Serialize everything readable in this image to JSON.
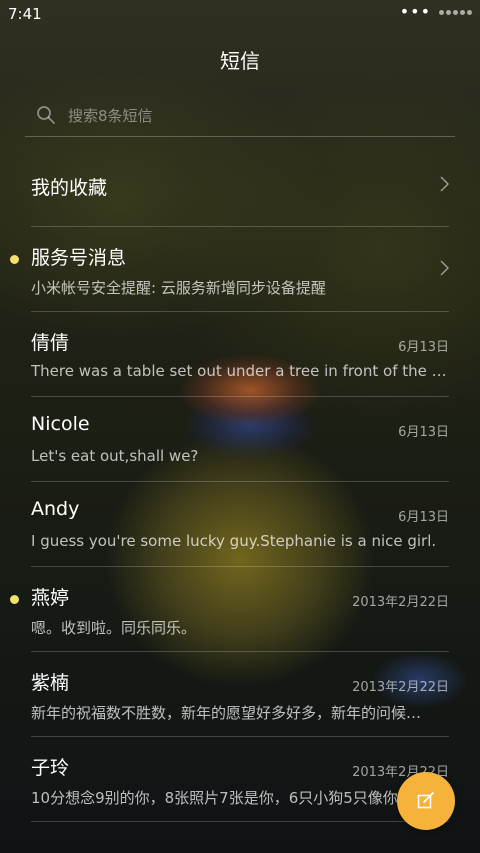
{
  "status_bar": {
    "time": "7:41",
    "menu_dots": "•••",
    "signal_icon": "signal-dots-icon"
  },
  "header": {
    "title": "短信"
  },
  "search": {
    "placeholder": "搜索8条短信",
    "icon": "search-icon"
  },
  "favorites": {
    "label": "我的收藏"
  },
  "messages": [
    {
      "name": "服务号消息",
      "preview": "小米帐号安全提醒: 云服务新增同步设备提醒",
      "date": "",
      "unread": true,
      "chevron": true
    },
    {
      "name": "倩倩",
      "preview": "There was a table set out under a tree in front of the ho…",
      "date": "6月13日",
      "unread": false,
      "chevron": false
    },
    {
      "name": "Nicole",
      "preview": "Let's eat out,shall we?",
      "date": "6月13日",
      "unread": false,
      "chevron": false
    },
    {
      "name": "Andy",
      "preview": "I guess you're some lucky guy.Stephanie is a nice girl.",
      "date": "6月13日",
      "unread": false,
      "chevron": false
    },
    {
      "name": "燕婷",
      "preview": "嗯。收到啦。同乐同乐。",
      "date": "2013年2月22日",
      "unread": true,
      "chevron": false
    },
    {
      "name": "紫楠",
      "preview": "新年的祝福数不胜数，新年的愿望好多好多，新年的问候…",
      "date": "2013年2月22日",
      "unread": false,
      "chevron": false
    },
    {
      "name": "子玲",
      "preview": "10分想念9别的你，8张照片7张是你，6只小狗5只像你…",
      "date": "2013年2月22日",
      "unread": false,
      "chevron": false
    }
  ],
  "fab": {
    "icon": "compose-icon"
  },
  "colors": {
    "accent": "#f5b33b",
    "unread_dot": "#f5e06a"
  }
}
